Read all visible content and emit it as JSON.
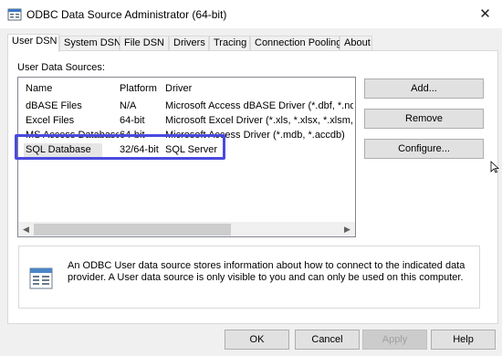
{
  "window": {
    "title": "ODBC Data Source Administrator (64-bit)",
    "close_symbol": "✕"
  },
  "tabs": [
    {
      "label": "User DSN",
      "active": true
    },
    {
      "label": "System DSN"
    },
    {
      "label": "File DSN"
    },
    {
      "label": "Drivers"
    },
    {
      "label": "Tracing"
    },
    {
      "label": "Connection Pooling"
    },
    {
      "label": "About"
    }
  ],
  "user_dsn": {
    "section_label": "User Data Sources:",
    "columns": [
      "Name",
      "Platform",
      "Driver"
    ],
    "rows": [
      {
        "name": "dBASE Files",
        "platform": "N/A",
        "driver": "Microsoft Access dBASE Driver (*.dbf, *.ndx, *.m"
      },
      {
        "name": "Excel Files",
        "platform": "64-bit",
        "driver": "Microsoft Excel Driver (*.xls, *.xlsx, *.xlsm, *.xlsb"
      },
      {
        "name": "MS Access Database",
        "platform": "64-bit",
        "driver": "Microsoft Access Driver (*.mdb, *.accdb)"
      },
      {
        "name": "SQL Database",
        "platform": "32/64-bit",
        "driver": "SQL Server",
        "selected": true
      }
    ],
    "buttons": {
      "add": "Add...",
      "remove": "Remove",
      "configure": "Configure..."
    },
    "info_text": "An ODBC User data source stores information about how to connect to the indicated data provider.  A User data source is only visible to you and can only be used on this computer."
  },
  "footer": {
    "ok": "OK",
    "cancel": "Cancel",
    "apply": "Apply",
    "help": "Help"
  },
  "colors": {
    "highlight": "#4a4adf",
    "selection": "#e5e5e5",
    "button_face": "#e1e1e1"
  }
}
